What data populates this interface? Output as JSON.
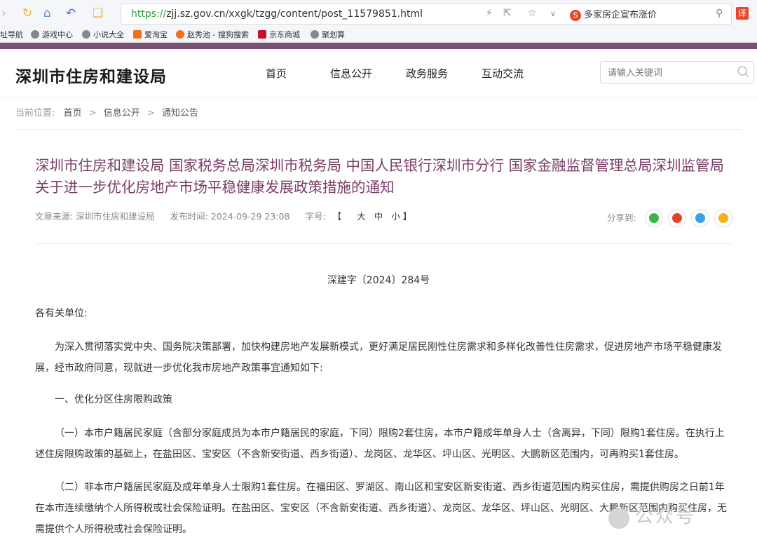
{
  "browser": {
    "url_scheme": "https://",
    "url_rest": "zjj.sz.gov.cn/xxgk/tzgg/content/post_11579851.html",
    "search_hint": "多家房企宣布涨价",
    "translate_glyph": "译",
    "ext_glyph": "S",
    "bookmarks": [
      {
        "label": "址导航"
      },
      {
        "label": "游戏中心"
      },
      {
        "label": "小说大全"
      },
      {
        "label": "爱淘宝"
      },
      {
        "label": "赵秀池 - 搜狗搜索"
      },
      {
        "label": "京东商城"
      },
      {
        "label": "聚划算"
      }
    ]
  },
  "site": {
    "logo": "深圳市住房和建设局",
    "menu": [
      {
        "label": "首页"
      },
      {
        "label": "信息公开"
      },
      {
        "label": "政务服务"
      },
      {
        "label": "互动交流"
      }
    ],
    "search_placeholder": "请输入关键词"
  },
  "breadcrumb": {
    "lead": "当前位置:",
    "items": [
      "首页",
      "信息公开",
      "通知公告"
    ],
    "sep": ">"
  },
  "article": {
    "title": "深圳市住房和建设局 国家税务总局深圳市税务局 中国人民银行深圳市分行 国家金融监督管理总局深圳监管局关于进一步优化房地产市场平稳健康发展政策措施的通知",
    "source": "文章来源: 深圳市住房和建设局",
    "publish_time": "发布时间: 2024-09-29 23:08",
    "font_size_label": "字号:",
    "font_size_open": "【",
    "font_size_large": "大",
    "font_size_medium": "中",
    "font_size_small": "小",
    "font_size_close": "】",
    "share_label": "分享到:",
    "doc_number": "深建字〔2024〕284号",
    "salutation": "各有关单位:",
    "intro": "为深入贯彻落实党中央、国务院决策部署，加快构建房地产发展新模式，更好满足居民刚性住房需求和多样化改善性住房需求，促进房地产市场平稳健康发展，经市政府同意，现就进一步优化我市房地产政策事宜通知如下:",
    "section1": "一、优化分区住房限购政策",
    "item1": "（一）本市户籍居民家庭（含部分家庭成员为本市户籍居民的家庭，下同）限购2套住房，本市户籍成年单身人士（含离异，下同）限购1套住房。在执行上述住房限购政策的基础上，在盐田区、宝安区（不含新安街道、西乡街道）、龙岗区、龙华区、坪山区、光明区、大鹏新区范围内，可再购买1套住房。",
    "item2": "（二）非本市户籍居民家庭及成年单身人士限购1套住房。在福田区、罗湖区、南山区和宝安区新安街道、西乡街道范围内购买住房，需提供购房之日前1年在本市连续缴纳个人所得税或社会保险证明。在盐田区、宝安区（不含新安街道、西乡街道）、龙岗区、龙华区、坪山区、光明区、大鹏新区范围内购买住房，无需提供个人所得税或社会保险证明。"
  },
  "watermark": "公众号"
}
